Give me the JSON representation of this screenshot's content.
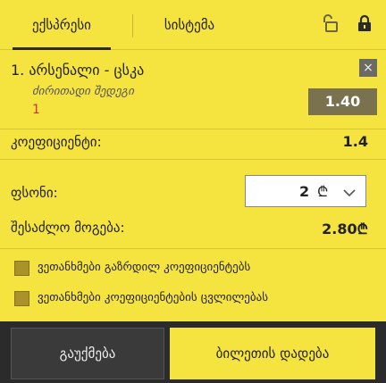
{
  "tabs": [
    {
      "label": "ექსპრესი",
      "active": true
    },
    {
      "label": "სისტემა",
      "active": false
    }
  ],
  "icons": {
    "lock_open": "lock-open-icon",
    "lock_closed": "lock-icon",
    "remove": "close-icon",
    "chevron": "chevron-down-icon"
  },
  "bet": {
    "number": "1.",
    "event": "არსენალი - ცსკა",
    "title": "1. არსენალი - ცსკა",
    "market": "ძირითადი შედეგი",
    "pick": "1",
    "odds": "1.40",
    "remove_label": "×"
  },
  "summary": {
    "coefficient_label": "კოეფიციენტი:",
    "coefficient_value": "1.4",
    "stake_label": "ფსონი:",
    "stake_value": "2",
    "currency": "₾",
    "payout_label": "შესაძლო მოგება:",
    "payout_value": "2.80₾"
  },
  "options": [
    {
      "label": "ვეთანხმები გაზრდილ კოეფიციენტებს",
      "checked": false
    },
    {
      "label": "ვეთანხმები კოეფიციენტების ცვლილებას",
      "checked": false
    }
  ],
  "buttons": {
    "cancel": "გაუქმება",
    "place": "ბილეთის დადება"
  },
  "colors": {
    "accent": "#f5e33f",
    "dark": "#2b2b2b",
    "odds": "#7a724f",
    "pick": "#d6302b"
  }
}
